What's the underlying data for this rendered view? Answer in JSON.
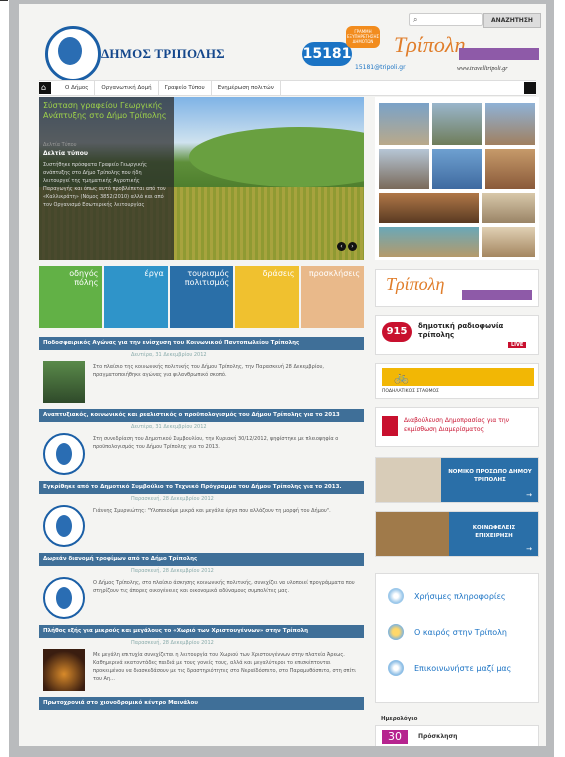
{
  "header": {
    "search_placeholder": "",
    "search_button": "ΑΝΑΖΗΤΗΣΗ",
    "municipality_name": "ΔΗΜΟΣ ΤΡΙΠΟΛΗΣ",
    "hotline_number": "15181",
    "hotline_tag": "ΓΡΑΜΜΗ ΕΞΥΠΗΡΕΤΗΣΗΣ ΔΗΜΟΤΩΝ",
    "hotline_email": "15181@tripoli.gr",
    "brand_script": "Τρίπολη",
    "brand_url": "www.travelltripoli.gr"
  },
  "nav": {
    "items": [
      "Ο Δήμος",
      "Οργανωτική Δομή",
      "Γραφείο Τύπου",
      "Ενημέρωση πολιτών"
    ]
  },
  "hero": {
    "title": "Σύσταση γραφείου Γεωργικής Ανάπτυξης στο Δήμο Τρίπολης",
    "date": "Δελτία Τύπου",
    "category": "Δελτία τύπου",
    "text": "Συστήθηκε πρόσφατα Γραφείο Γεωργικής ανάπτυξης στο Δήμο Τρίπολης που ήδη λειτουργεί της τμηματικής Αγροτικής Παραγωγής και όπως αυτό προβλέπεται από τον «Καλλικράτη» (Νόμος 3852/2010) αλλά και από τον Οργανισμό Εσωτερικής λειτουργίας"
  },
  "tiles": [
    {
      "label": "οδηγός πόλης",
      "color": "#62b146"
    },
    {
      "label": "έργα",
      "color": "#2f94c9"
    },
    {
      "label": "τουρισμός πολιτισμός",
      "color": "#2a6fa8"
    },
    {
      "label": "δράσεις",
      "color": "#f0c12f"
    },
    {
      "label": "προσκλήσεις",
      "color": "#e9b98a"
    }
  ],
  "news": [
    {
      "title": "Ποδοσφαιρικός Αγώνας για την ενίσχυση του Κοινωνικού Παντοπωλείου Τρίπολης",
      "date": "Δευτέρα, 31 Δεκεμβρίου 2012",
      "text": "Στο πλαίσιο της κοινωνικής πολιτικής του Δήμου Τρίπολης, την Παρασκευή 28 Δεκεμβρίου, πραγματοποιήθηκε αγώνας για φιλανθρωπικό σκοπό.",
      "thumb": "photo"
    },
    {
      "title": "Αναπτυξιακός, κοινωνικός και ρεαλιστικός ο προϋπολογισμός του Δήμου Τρίπολης για το 2013",
      "date": "Δευτέρα, 31 Δεκεμβρίου 2012",
      "text": "Στη συνεδρίαση του Δημοτικού Συμβουλίου, την Κυριακή 30/12/2012, ψηφίστηκε με πλειοψηφία ο προϋπολογισμός του Δήμου Τρίπολης για το 2013.",
      "thumb": "seal"
    },
    {
      "title": "Εγκρίθηκε από το Δημοτικό Συμβούλιο το Τεχνικό Πρόγραμμα του Δήμου Τρίπολης για το 2013.",
      "date": "Παρασκευή, 28 Δεκεμβρίου 2012",
      "text": "Γιάννης Σμυρνιώτης: \"Υλοποιούμε μικρά και μεγάλα έργα που αλλάζουν τη μορφή του Δήμου\".",
      "thumb": "seal"
    },
    {
      "title": "Δωρεάν διανομή τροφίμων από το Δήμο Τρίπολης",
      "date": "Παρασκευή, 28 Δεκεμβρίου 2012",
      "text": "Ο Δήμος Τρίπολης, στο πλαίσιο άσκησης κοινωνικής πολιτικής, συνεχίζει να υλοποιεί προγράμματα που στηρίζουν τις άπορες οικογένειες και οικονομικά αδύναμους συμπολίτες μας.",
      "thumb": "seal"
    },
    {
      "title": "Πλήθος εξής για μικρούς και μεγάλους το «Χωριό των Χριστουγέννων» στην Τρίπολη",
      "date": "Παρασκευή, 28 Δεκεμβρίου 2012",
      "text": "Με μεγάλη επιτυχία συνεχίζεται η λειτουργία του Χωριού των Χριστουγέννων στην πλατεία Άρεως. Καθημερινά εκατοντάδες παιδιά με τους γονείς τους, αλλά και μεγαλύτεροι το επισκέπτονται προκειμένου να διασκεδάσουν με τις δραστηριότητες στο Νεραϊδόσπιτο, στο Παραμυθόσπιτο, στη σπίτι του Αη...",
      "thumb": "night"
    },
    {
      "title": "Πρωτοχρονιά στο χιονοδρομικό κέντρο Μαινάλου",
      "date": "",
      "text": "",
      "thumb": ""
    }
  ],
  "sidebar": {
    "tripoli_banner_script": "Τρίπολη",
    "radio_number": "915",
    "radio_label": "δημοτική ραδιοφωνία τρίπολης",
    "radio_live": "LIVE",
    "bike_label": "ΠΟΔΗΛΑΤΙΚΟΣ ΣΤΑΘΜΟΣ",
    "consultation_label": "Διαβούλευση Δημοπρασίας για την εκμίσθωση Διαμερίσματος",
    "npdd_label": "ΝΟΜΙΚΟ ΠΡΟΣΩΠΟ ΔΗΜΟΥ ΤΡΙΠΟΛΗΣ",
    "enterprises_label": "ΚΟΙΝΩΦΕΛΕΙΣ ΕΠΙΧΕΙΡΗΣΗ",
    "useful": [
      "Χρήσιμες πληροφορίες",
      "Ο καιρός στην Τρίπολη",
      "Επικοινωνήστε μαζί μας"
    ],
    "calendar_title": "Ημερολόγιο",
    "calendar_day": "30",
    "calendar_label": "Πρόσκληση"
  }
}
